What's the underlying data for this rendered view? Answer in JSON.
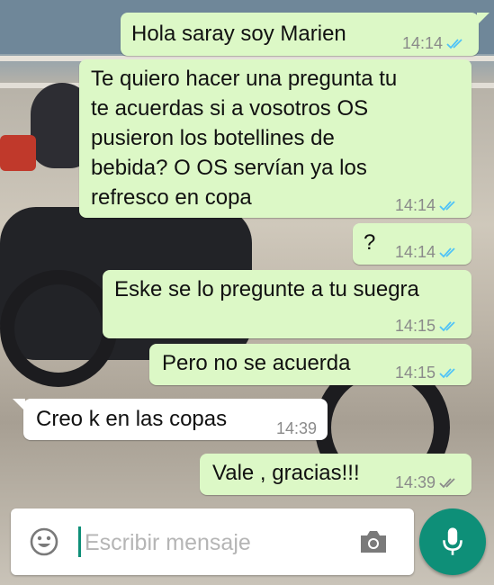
{
  "colors": {
    "outgoing_bubble": "#dcf8c6",
    "incoming_bubble": "#ffffff",
    "tick_read": "#4fc3f7",
    "tick_sent": "#8a8a8a",
    "accent": "#0e8f78"
  },
  "messages": [
    {
      "direction": "outgoing",
      "lines": [
        "Hola saray soy Marien"
      ],
      "time": "14:14",
      "status": "read"
    },
    {
      "direction": "outgoing",
      "lines": [
        "Te quiero hacer una pregunta tu",
        "te acuerdas si a vosotros OS",
        "pusieron los botellines de",
        "bebida? O OS servían ya los",
        "refresco en copa"
      ],
      "time": "14:14",
      "status": "read"
    },
    {
      "direction": "outgoing",
      "lines": [
        "?"
      ],
      "time": "14:14",
      "status": "read"
    },
    {
      "direction": "outgoing",
      "lines": [
        "Eske se lo pregunte a tu suegra"
      ],
      "time": "14:15",
      "status": "read"
    },
    {
      "direction": "outgoing",
      "lines": [
        "Pero no se acuerda"
      ],
      "time": "14:15",
      "status": "read"
    },
    {
      "direction": "incoming",
      "lines": [
        "Creo k en las copas"
      ],
      "time": "14:39"
    },
    {
      "direction": "outgoing",
      "lines": [
        "Vale , gracias!!!"
      ],
      "time": "14:39",
      "status": "delivered"
    }
  ],
  "composer": {
    "placeholder": "Escribir mensaje",
    "emoji_icon": "emoji-icon",
    "camera_icon": "camera-icon",
    "mic_icon": "microphone-icon"
  }
}
